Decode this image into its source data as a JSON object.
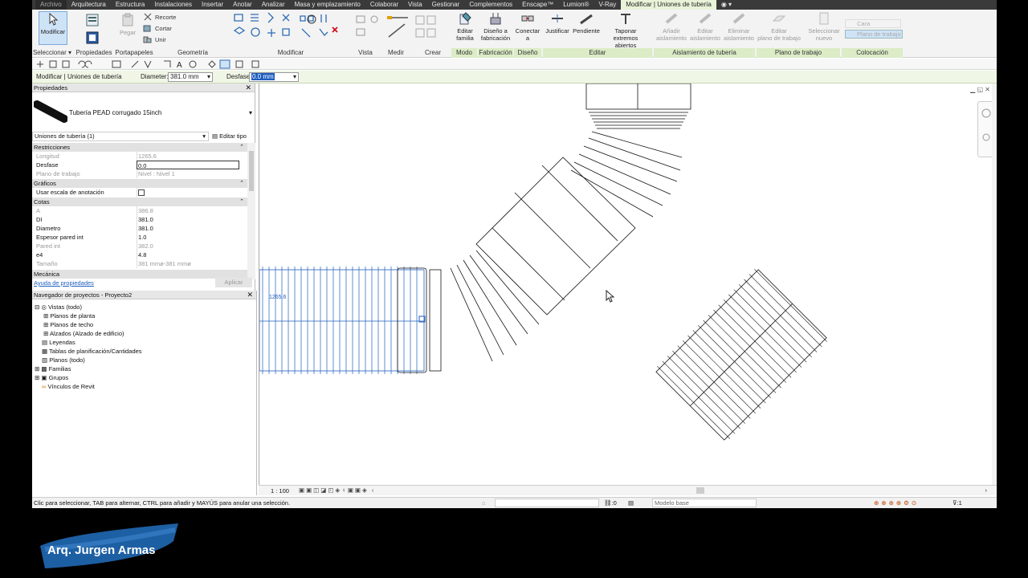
{
  "tabs": [
    "Archivo",
    "Arquitectura",
    "Estructura",
    "Instalaciones",
    "Insertar",
    "Anotar",
    "Analizar",
    "Masa y emplazamiento",
    "Colaborar",
    "Vista",
    "Gestionar",
    "Complementos",
    "Enscape™",
    "Lumion®",
    "V-Ray",
    "Modificar | Uniones de tubería"
  ],
  "ribbon": {
    "modify_label": "Modificar",
    "select_label": "Seleccionar ▾",
    "properties_label": "Propiedades",
    "clipboard_label": "Portapapeles",
    "geometry_label": "Geometría",
    "modify_panel_label": "Modificar",
    "view_label": "Vista",
    "measure_label": "Medir",
    "create_label": "Crear",
    "mode_label": "Modo",
    "fabrication_label": "Fabricación",
    "design_label": "Diseño",
    "edit_label": "Editar",
    "insulation_label": "Aislamiento de tubería",
    "workplane_label": "Plano de trabajo",
    "placement_label": "Colocación",
    "paste": "Pegar",
    "cope": "Recorte",
    "cut": "Cortar",
    "join": "Unir",
    "edit_family": "Editar\nfamilia",
    "fab_design": "Diseño a\nfabricación",
    "connect_to": "Conectar\na",
    "justify": "Justificar",
    "slope": "Pendiente",
    "cap_open": "Taponar\nextremos abiertos",
    "add_insul": "Añadir\naislamiento",
    "edit_insul": "Editar\naislamiento",
    "remove_insul": "Eliminar\naislamiento",
    "edit_workplane": "Editar\nplano de trabajo",
    "select_new": "Seleccionar\nnuevo",
    "face": "Cara",
    "workplane_opt": "Plano de trabajo"
  },
  "options_bar": {
    "context": "Modificar | Uniones de tubería",
    "diameter_label": "Diameter:",
    "diameter_value": "381.0 mm",
    "offset_label": "Desfase:",
    "offset_value": "0.0 mm"
  },
  "properties": {
    "title": "Propiedades",
    "type_name": "Tubería PEAD corrugado 15inch",
    "filter": "Uniones de tubería (1)",
    "edit_type": "Editar tipo",
    "sections": {
      "constraints": "Restricciones",
      "graphics": "Gráficos",
      "dimensions": "Cotas",
      "mechanical": "Mecánica"
    },
    "rows": [
      {
        "k": "Longitud",
        "v": "1265.6",
        "grey": true
      },
      {
        "k": "Desfase",
        "v": "0.0",
        "grey": false
      },
      {
        "k": "Plano de trabajo",
        "v": "Nivel : Nivel 1",
        "grey": true
      },
      {
        "k": "Usar escala de anotación",
        "v": "",
        "grey": false
      },
      {
        "k": "A",
        "v": "386.8",
        "grey": true
      },
      {
        "k": "DI",
        "v": "381.0",
        "grey": false
      },
      {
        "k": "Diametro",
        "v": "381.0",
        "grey": false
      },
      {
        "k": "Espesor pared int",
        "v": "1.0",
        "grey": false
      },
      {
        "k": "Pared int",
        "v": "382.0",
        "grey": true
      },
      {
        "k": "e4",
        "v": "4.8",
        "grey": false
      },
      {
        "k": "Tamaño",
        "v": "381 mmø-381 mmø",
        "grey": true
      }
    ],
    "help_link": "Ayuda de propiedades",
    "apply": "Aplicar"
  },
  "browser": {
    "title": "Navegador de proyectos - Proyecto2",
    "items": [
      "Vistas (todo)",
      "Planos de planta",
      "Planos de techo",
      "Alzados (Alzado de edificio)",
      "Leyendas",
      "Tablas de planificación/Cantidades",
      "Planos (todo)",
      "Familias",
      "Grupos",
      "Vínculos de Revit"
    ]
  },
  "canvas": {
    "dimension_text": "1265.6"
  },
  "view_bar": {
    "scale": "1 : 100"
  },
  "status": {
    "hint": "Clic para seleccionar, TAB para alternar, CTRL para añadir y MAYÚS para anular una selección.",
    "selected_count": ":0",
    "model": "Modelo base",
    "filter_count": ":1"
  },
  "watermark": "Arq. Jurgen Armas",
  "colors": {
    "accent": "#dbecc6",
    "selection": "#1f5fbf",
    "logo": "#1d5fa3"
  }
}
